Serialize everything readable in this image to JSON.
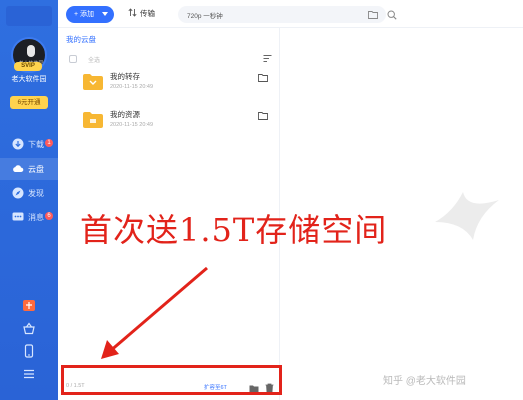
{
  "sidebar": {
    "avatar_caption": "老大软件园",
    "vip_badge": "SVIP",
    "username": "老大软件园",
    "open_button": "6元开通",
    "nav": [
      {
        "label": "下载",
        "badge": "1",
        "icon": "download-icon"
      },
      {
        "label": "云盘",
        "badge": "",
        "icon": "cloud-icon"
      },
      {
        "label": "发现",
        "badge": "",
        "icon": "compass-icon"
      },
      {
        "label": "消息",
        "badge": "6",
        "icon": "message-icon"
      }
    ],
    "bottom_icons": [
      "gift-icon",
      "basket-icon",
      "phone-icon",
      "menu-icon"
    ]
  },
  "topbar": {
    "add_label": "添加",
    "transfer_label": "传输",
    "search_value": "720p 一秒钟"
  },
  "panel": {
    "breadcrumb": "我的云盘",
    "select_all": "全选",
    "files": [
      {
        "name": "我的转存",
        "date": "2020-11-15 20:49"
      },
      {
        "name": "我的资源",
        "date": "2020-11-15 20:49"
      }
    ],
    "storage_used": "0 / 1.5T",
    "expand_label": "扩容至6T"
  },
  "overlay": {
    "promo_text": "首次送1.5T存储空间"
  },
  "watermark": {
    "credit": "知乎 @老大软件园"
  },
  "colors": {
    "sidebar": "#2f6fe0",
    "accent": "#3370ff",
    "annotation": "#e2231a",
    "folder": "#f7b733"
  }
}
